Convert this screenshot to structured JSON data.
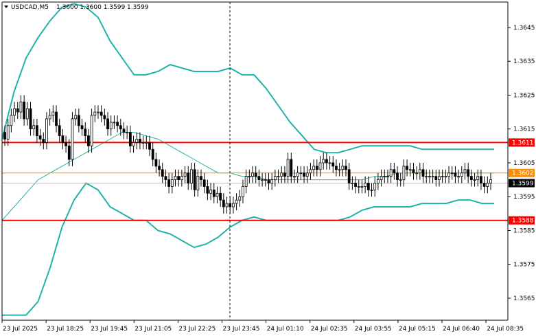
{
  "header": {
    "symbol": "USDCAD,M5",
    "ohlc": "1.3600 1.3600 1.3599 1.3599"
  },
  "chart_data": {
    "type": "candlestick",
    "ylim": [
      1.35585,
      1.36525
    ],
    "yticks": [
      "1.3645",
      "1.3635",
      "1.3625",
      "1.3615",
      "1.3605",
      "1.3595",
      "1.3585",
      "1.3575",
      "1.3565"
    ],
    "xticks": [
      "23 Jul 2025",
      "23 Jul 18:25",
      "23 Jul 19:45",
      "23 Jul 21:05",
      "23 Jul 22:25",
      "23 Jul 23:45",
      "24 Jul 01:10",
      "24 Jul 02:35",
      "24 Jul 03:55",
      "24 Jul 05:15",
      "24 Jul 06:40",
      "24 Jul 08:35"
    ],
    "grid": false,
    "levels": [
      {
        "label": "1.3611",
        "value": 1.3611,
        "color": "#ff0000"
      },
      {
        "label": "1.3602",
        "value": 1.3602,
        "color": "#ff8c00"
      },
      {
        "label": "1.3599",
        "value": 1.3599,
        "color": "#c0c0c0"
      },
      {
        "label": "1.3588",
        "value": 1.3588,
        "color": "#ff0000"
      }
    ],
    "candles_close": [
      1.3612,
      1.3616,
      1.3619,
      1.3621,
      1.362,
      1.3623,
      1.3618,
      1.3621,
      1.3615,
      1.3616,
      1.3613,
      1.3612,
      1.3611,
      1.3618,
      1.3619,
      1.362,
      1.3616,
      1.3613,
      1.3611,
      1.361,
      1.3606,
      1.3618,
      1.3619,
      1.3616,
      1.3615,
      1.3613,
      1.361,
      1.3619,
      1.362,
      1.362,
      1.3619,
      1.3618,
      1.3615,
      1.3617,
      1.3617,
      1.3616,
      1.3615,
      1.3614,
      1.3614,
      1.361,
      1.3611,
      1.3612,
      1.3611,
      1.3611,
      1.3611,
      1.3609,
      1.3606,
      1.3604,
      1.3603,
      1.3601,
      1.36,
      1.3598,
      1.36,
      1.3601,
      1.36,
      1.3601,
      1.3602,
      1.3599,
      1.3603,
      1.3597,
      1.3601,
      1.36,
      1.3598,
      1.3596,
      1.3597,
      1.3595,
      1.3596,
      1.3594,
      1.3592,
      1.3593,
      1.3592,
      1.3593,
      1.3594,
      1.3595,
      1.3598,
      1.3601,
      1.3601,
      1.3602,
      1.3601,
      1.36,
      1.36,
      1.36,
      1.3599,
      1.36,
      1.3601,
      1.3601,
      1.3602,
      1.3601,
      1.3606,
      1.3601,
      1.3601,
      1.3602,
      1.3602,
      1.3601,
      1.3602,
      1.3603,
      1.3604,
      1.3603,
      1.3605,
      1.3606,
      1.3605,
      1.3605,
      1.3604,
      1.3603,
      1.3603,
      1.3604,
      1.3603,
      1.3599,
      1.3599,
      1.3598,
      1.3598,
      1.3598,
      1.3599,
      1.3597,
      1.3597,
      1.3599,
      1.36,
      1.3601,
      1.3601,
      1.3601,
      1.3603,
      1.3602,
      1.36,
      1.36,
      1.3604,
      1.3603,
      1.3603,
      1.3602,
      1.3602,
      1.3603,
      1.3601,
      1.3601,
      1.3601,
      1.3601,
      1.36,
      1.3601,
      1.3601,
      1.3601,
      1.3602,
      1.3602,
      1.3601,
      1.3601,
      1.3602,
      1.3603,
      1.3601,
      1.36,
      1.36,
      1.3601,
      1.3599,
      1.3598,
      1.3599,
      1.36
    ],
    "bollinger_upper": [
      1.3612,
      1.3626,
      1.3636,
      1.3642,
      1.3647,
      1.3651,
      1.3652,
      1.3651,
      1.3648,
      1.3641,
      1.3636,
      1.3631,
      1.3631,
      1.3632,
      1.3634,
      1.3633,
      1.3632,
      1.3632,
      1.3632,
      1.3633,
      1.3631,
      1.3631,
      1.3627,
      1.3622,
      1.3617,
      1.3613,
      1.3609,
      1.3608,
      1.3608,
      1.3609,
      1.361,
      1.361,
      1.361,
      1.361,
      1.361,
      1.3609,
      1.3609,
      1.3609,
      1.3609,
      1.3609,
      1.3609,
      1.3609
    ],
    "bollinger_middle": [
      1.3588,
      1.3592,
      1.3596,
      1.36,
      1.3602,
      1.3604,
      1.3606,
      1.3608,
      1.361,
      1.3612,
      1.3614,
      1.3614,
      1.3613,
      1.3612,
      1.361,
      1.3608,
      1.3606,
      1.3604,
      1.3602,
      1.3602,
      1.3601,
      1.3601,
      1.36,
      1.36,
      1.36,
      1.36,
      1.36,
      1.36,
      1.36,
      1.36,
      1.36,
      1.3601,
      1.3601,
      1.3602,
      1.3602,
      1.3602,
      1.3602,
      1.3602,
      1.3602,
      1.3602,
      1.3602,
      1.3602
    ],
    "bollinger_lower": [
      1.356,
      1.356,
      1.356,
      1.3564,
      1.3574,
      1.3586,
      1.3594,
      1.3599,
      1.3597,
      1.3592,
      1.359,
      1.3588,
      1.3588,
      1.3585,
      1.3584,
      1.3582,
      1.358,
      1.3581,
      1.3583,
      1.3586,
      1.3588,
      1.3589,
      1.3588,
      1.3588,
      1.3588,
      1.3588,
      1.3588,
      1.3588,
      1.3588,
      1.3589,
      1.3591,
      1.3592,
      1.3592,
      1.3592,
      1.3592,
      1.3593,
      1.3593,
      1.3593,
      1.3594,
      1.3594,
      1.3593,
      1.3593
    ],
    "colors": {
      "band": "#20b2aa",
      "mid": "#20b2aa",
      "candle": "#000000",
      "axis": "#000000",
      "cursor": "#000000"
    }
  }
}
